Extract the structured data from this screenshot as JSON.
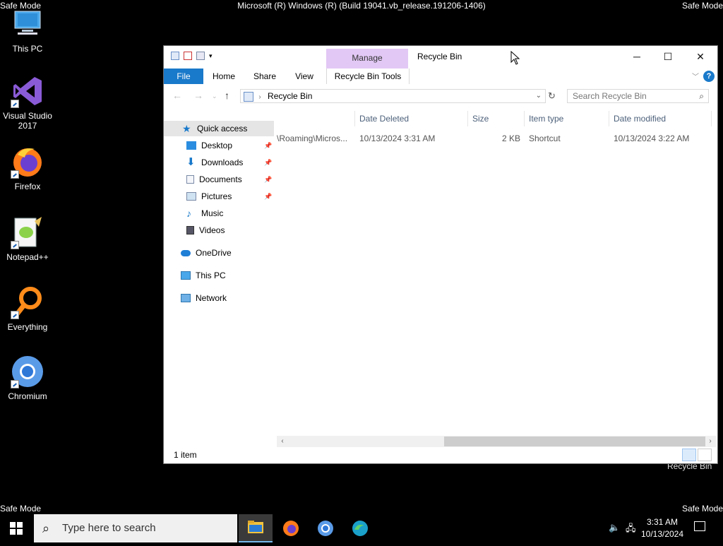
{
  "system": {
    "safe_mode": "Safe Mode",
    "build_info": "Microsoft (R) Windows (R) (Build 19041.vb_release.191206-1406)"
  },
  "desktop_icons": [
    {
      "label": "This PC"
    },
    {
      "label": "Visual Studio 2017"
    },
    {
      "label": "Firefox"
    },
    {
      "label": "Notepad++"
    },
    {
      "label": "Everything"
    },
    {
      "label": "Chromium"
    }
  ],
  "recycle_bin_label": "Recycle Bin",
  "window": {
    "title": "Recycle Bin",
    "manage_tab": "Manage",
    "ribbon_tabs": {
      "file": "File",
      "home": "Home",
      "share": "Share",
      "view": "View",
      "tools": "Recycle Bin Tools"
    },
    "address": "Recycle Bin",
    "search_placeholder": "Search Recycle Bin",
    "nav": {
      "quick_access": "Quick access",
      "desktop": "Desktop",
      "downloads": "Downloads",
      "documents": "Documents",
      "pictures": "Pictures",
      "music": "Music",
      "videos": "Videos",
      "onedrive": "OneDrive",
      "this_pc": "This PC",
      "network": "Network"
    },
    "columns": {
      "date_deleted": "Date Deleted",
      "size": "Size",
      "item_type": "Item type",
      "date_modified": "Date modified"
    },
    "rows": [
      {
        "location": "\\Roaming\\Micros...",
        "date_deleted": "10/13/2024 3:31 AM",
        "size": "2 KB",
        "item_type": "Shortcut",
        "date_modified": "10/13/2024 3:22 AM"
      }
    ],
    "status": "1 item"
  },
  "taskbar": {
    "search_placeholder": "Type here to search",
    "time": "3:31 AM",
    "date": "10/13/2024"
  },
  "colors": {
    "accent": "#1979ca",
    "manage": "#e2c8f5"
  }
}
